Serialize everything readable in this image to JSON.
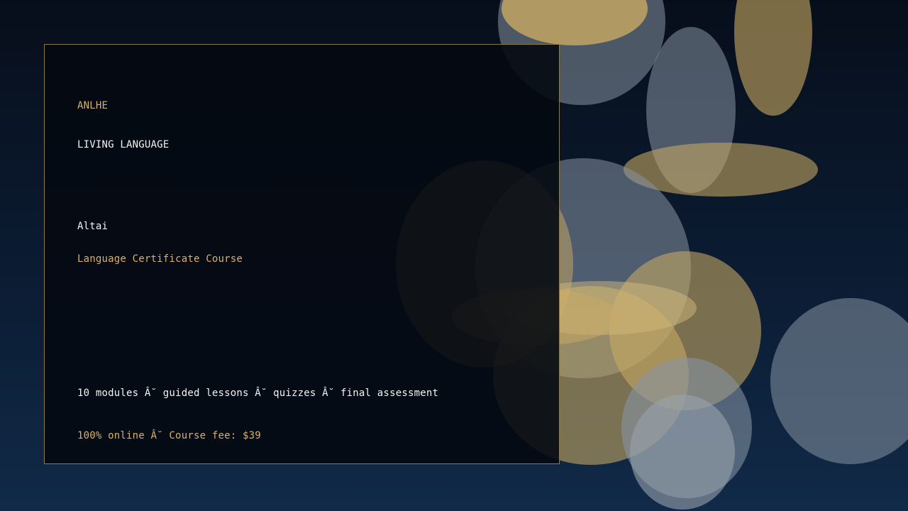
{
  "brand": {
    "name": "ANLHE",
    "tagline": "LIVING LANGUAGE"
  },
  "course": {
    "language": "Altai",
    "title": "Language Certificate Course",
    "details": "10 modules Â˘ guided lessons Â˘ quizzes Â˘ final assessment",
    "pricing": "100% online Â˘ Course fee: $39"
  },
  "colors": {
    "accent_gold": "#d8b169",
    "card_border": "#8c7a4a",
    "background_top": "#070e1b",
    "background_bottom": "#112a48",
    "bokeh_gold": "#c9aa63",
    "bokeh_gray": "#8794a3"
  }
}
